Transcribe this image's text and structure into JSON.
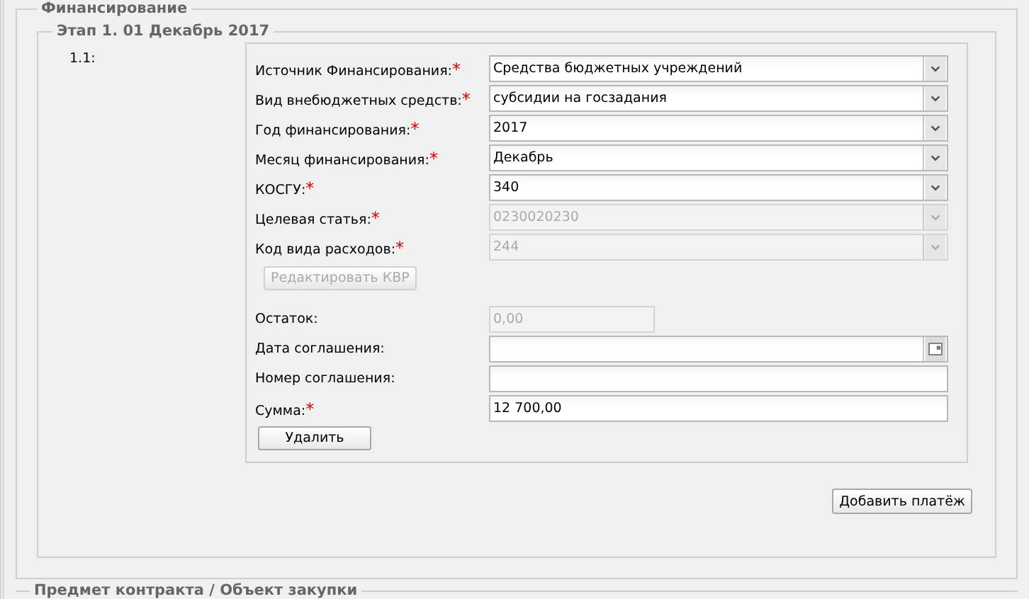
{
  "section": {
    "legend": "Финансирование"
  },
  "stage": {
    "legend": "Этап 1. 01 Декабрь 2017",
    "index_label": "1.1:"
  },
  "rows": [
    {
      "kind": "select",
      "label": "Источник Финансирования:",
      "required_mark": "*",
      "value": "Средства бюджетных учреждений",
      "disabled": false
    },
    {
      "kind": "select",
      "label": "Вид внебюджетных средств:",
      "required_mark": "*",
      "value": "субсидии на госзадания",
      "disabled": false
    },
    {
      "kind": "select",
      "label": "Год финансирования:",
      "required_mark": "*",
      "value": "2017",
      "disabled": false
    },
    {
      "kind": "select",
      "label": "Месяц финансирования:",
      "required_mark": "*",
      "value": "Декабрь",
      "disabled": false
    },
    {
      "kind": "select",
      "label": "КОСГУ:",
      "required_mark": "*",
      "value": "340",
      "disabled": false
    },
    {
      "kind": "select",
      "label": "Целевая статья:",
      "required_mark": "*",
      "value": "0230020230",
      "disabled": true
    },
    {
      "kind": "select",
      "label": "Код вида расходов:",
      "required_mark": "*",
      "value": "244",
      "disabled": true
    },
    {
      "kind": "button",
      "label": "Редактировать КВР",
      "disabled": true
    },
    {
      "kind": "short_text",
      "label": "Остаток:",
      "value": "0,00",
      "disabled": true
    },
    {
      "kind": "date",
      "label": "Дата соглашения:",
      "disabled": false
    },
    {
      "kind": "text",
      "label": "Номер соглашения:",
      "disabled": false
    },
    {
      "kind": "text",
      "label": "Сумма:",
      "required_mark": "*",
      "value": "12 700,00",
      "disabled": false
    }
  ],
  "delete_button": "Удалить",
  "add_button": "Добавить платёж",
  "next_section": {
    "legend": "Предмет контракта / Объект закупки"
  }
}
